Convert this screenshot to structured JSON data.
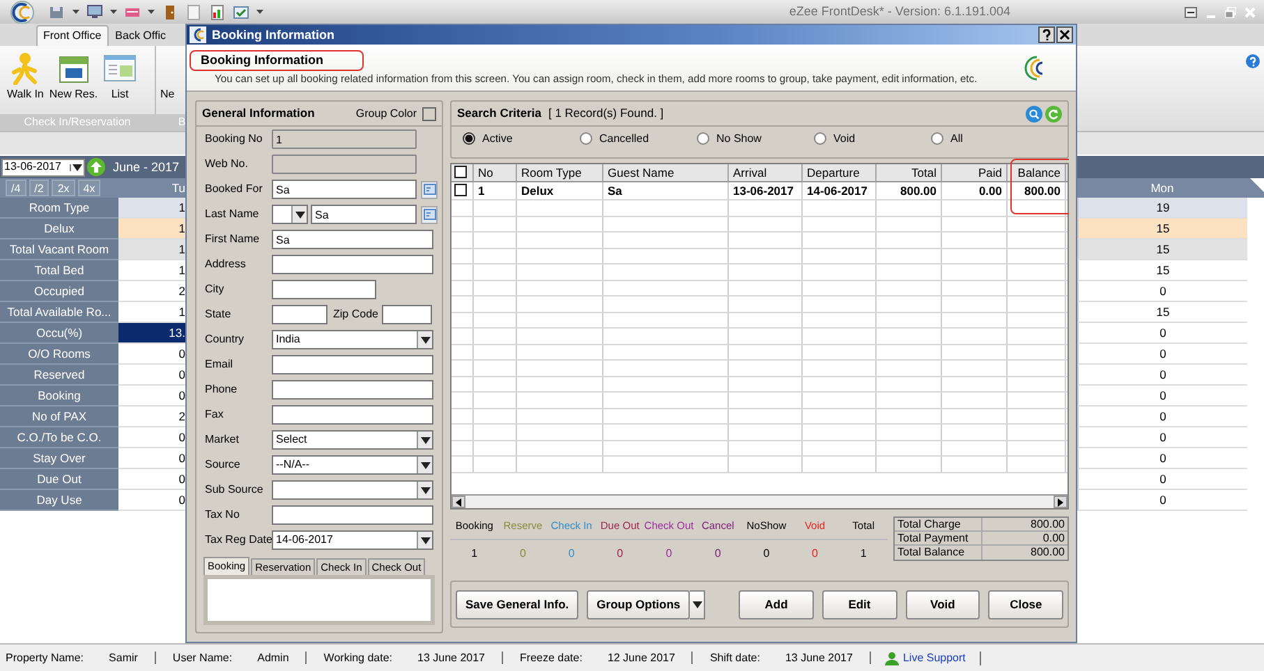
{
  "app": {
    "title": "eZee FrontDesk* - Version: 6.1.191.004",
    "ribbon_tabs": [
      {
        "label": "Front Office",
        "selected": true
      },
      {
        "label": "Back Offic",
        "selected": false
      }
    ],
    "ribbon_buttons": [
      {
        "label": "Walk In",
        "kind": "walkin"
      },
      {
        "label": "New Res.",
        "kind": "calendar"
      },
      {
        "label": "List",
        "kind": "list"
      },
      {
        "label": "Ne",
        "kind": "partial"
      }
    ],
    "ribbon_groups": [
      "Check In/Reservation",
      "B"
    ]
  },
  "planner": {
    "date": "13-06-2017",
    "month": "June - 2017",
    "zoom_buttons": [
      "/4",
      "/2",
      "2x",
      "4x"
    ],
    "column_1": "Tu",
    "column_2": "Mon",
    "rows": [
      {
        "label": "Room Type",
        "kind": "header",
        "column_1": "1",
        "column_2": "19"
      },
      {
        "label": "Delux",
        "kind": "room",
        "column_1": "1",
        "column_2": "15"
      },
      {
        "label": "Total Vacant Room",
        "kind": "vacant",
        "column_1": "1",
        "column_2": "15"
      },
      {
        "label": "Total Bed",
        "kind": "normal",
        "column_1": "1",
        "column_2": "15"
      },
      {
        "label": "Occupied",
        "kind": "normal",
        "column_1": "2",
        "column_2": "0"
      },
      {
        "label": "Total Available Ro...",
        "kind": "normal",
        "column_1": "1",
        "column_2": "15"
      },
      {
        "label": "Occu(%)",
        "kind": "occupancy",
        "column_1": "13.",
        "column_2": "0"
      },
      {
        "label": "O/O Rooms",
        "kind": "normal",
        "column_1": "0",
        "column_2": "0"
      },
      {
        "label": "Reserved",
        "kind": "normal",
        "column_1": "0",
        "column_2": "0"
      },
      {
        "label": "Booking",
        "kind": "normal",
        "column_1": "0",
        "column_2": "0"
      },
      {
        "label": "No of PAX",
        "kind": "normal",
        "column_1": "2",
        "column_2": "0"
      },
      {
        "label": "C.O./To be C.O.",
        "kind": "normal",
        "column_1": "0",
        "column_2": "0"
      },
      {
        "label": "Stay Over",
        "kind": "normal",
        "column_1": "0",
        "column_2": "0"
      },
      {
        "label": "Due Out",
        "kind": "normal",
        "column_1": "0",
        "column_2": "0"
      },
      {
        "label": "Day Use",
        "kind": "normal",
        "column_1": "0",
        "column_2": "0"
      }
    ]
  },
  "dialog": {
    "title": "Booking Information",
    "heading": "Booking Information",
    "heading_highlighted": true,
    "description": "You can set up all booking related information from this screen. You can assign room, check in them, add more rooms to group, take payment, edit information, etc.",
    "general": {
      "title": "General Information",
      "group_color_label": "Group Color",
      "fields": [
        {
          "label": "Booking No",
          "kind": "readonly",
          "value": "1"
        },
        {
          "label": "Web No.",
          "kind": "readonly"
        },
        {
          "label": "Booked For",
          "kind": "lookup",
          "value": "Sa"
        },
        {
          "label": "Last Name",
          "kind": "title-lookup",
          "value": "Sa"
        },
        {
          "label": "First Name",
          "kind": "text",
          "value": "Sa"
        },
        {
          "label": "Address",
          "kind": "text"
        },
        {
          "label": "City",
          "kind": "short"
        },
        {
          "label": "State",
          "kind": "pair",
          "second_label": "Zip Code"
        },
        {
          "label": "Country",
          "kind": "select",
          "value": "India"
        },
        {
          "label": "Email",
          "kind": "text"
        },
        {
          "label": "Phone",
          "kind": "text"
        },
        {
          "label": "Fax",
          "kind": "text"
        },
        {
          "label": "Market",
          "kind": "select",
          "value": "Select"
        },
        {
          "label": "Source",
          "kind": "select",
          "value": "--N/A--"
        },
        {
          "label": "Sub Source",
          "kind": "select"
        },
        {
          "label": "Tax No",
          "kind": "text"
        },
        {
          "label": "Tax Reg Date",
          "kind": "select",
          "value": "14-06-2017"
        }
      ],
      "tabs": [
        {
          "label": "Booking",
          "selected": true
        },
        {
          "label": "Reservation",
          "selected": false
        },
        {
          "label": "Check In",
          "selected": false
        },
        {
          "label": "Check Out",
          "selected": false
        }
      ]
    },
    "search": {
      "title": "Search Criteria",
      "found": "[ 1 Record(s) Found. ]",
      "filters": [
        {
          "label": "Active",
          "selected": true
        },
        {
          "label": "Cancelled",
          "selected": false
        },
        {
          "label": "No Show",
          "selected": false
        },
        {
          "label": "Void",
          "selected": false
        },
        {
          "label": "All",
          "selected": false
        }
      ],
      "select_all_checked": false,
      "columns": [
        {
          "label": "No",
          "kind": "text",
          "highlighted": false
        },
        {
          "label": "Room Type",
          "kind": "text",
          "highlighted": false
        },
        {
          "label": "Guest Name",
          "kind": "text",
          "highlighted": false
        },
        {
          "label": "Arrival",
          "kind": "text",
          "highlighted": false
        },
        {
          "label": "Departure",
          "kind": "text",
          "highlighted": false
        },
        {
          "label": "Total",
          "kind": "number",
          "highlighted": false
        },
        {
          "label": "Paid",
          "kind": "number",
          "highlighted": false
        },
        {
          "label": "Balance",
          "kind": "number",
          "highlighted": true
        }
      ],
      "rows": [
        {
          "checked": false,
          "cells": [
            "1",
            "Delux",
            "Sa",
            "13-06-2017",
            "14-06-2017",
            "800.00",
            "0.00",
            "800.00"
          ]
        }
      ],
      "stats": [
        {
          "label": "Booking",
          "value": "1",
          "color": "#000000"
        },
        {
          "label": "Reserve",
          "value": "0",
          "color": "#8a8a3c"
        },
        {
          "label": "Check In",
          "value": "0",
          "color": "#2f8fc8"
        },
        {
          "label": "Due Out",
          "value": "0",
          "color": "#a0244c"
        },
        {
          "label": "Check Out",
          "value": "0",
          "color": "#9c2c9c"
        },
        {
          "label": "Cancel",
          "value": "0",
          "color": "#80207a"
        },
        {
          "label": "NoShow",
          "value": "0",
          "color": "#000000"
        },
        {
          "label": "Void",
          "value": "0",
          "color": "#e8221c"
        },
        {
          "label": "Total",
          "value": "1",
          "color": "#000000"
        }
      ],
      "totals": [
        {
          "label": "Total Charge",
          "value": "800.00"
        },
        {
          "label": "Total Payment",
          "value": "0.00"
        },
        {
          "label": "Total Balance",
          "value": "800.00"
        }
      ]
    },
    "buttons": [
      {
        "label": "Save General Info.",
        "kind": "plain"
      },
      {
        "label": "Group Options",
        "kind": "split"
      },
      {
        "label": "Add",
        "kind": "action"
      },
      {
        "label": "Edit",
        "kind": "action"
      },
      {
        "label": "Void",
        "kind": "action"
      },
      {
        "label": "Close",
        "kind": "action"
      }
    ]
  },
  "status_bar": {
    "items": [
      {
        "label": "Property Name:",
        "value": "Samir"
      },
      {
        "label": "User Name:",
        "value": "Admin"
      },
      {
        "label": "Working date:",
        "value": "13 June 2017"
      },
      {
        "label": "Freeze date:",
        "value": "12 June 2017"
      },
      {
        "label": "Shift date:",
        "value": "13 June 2017"
      }
    ],
    "link": "Live Support"
  }
}
